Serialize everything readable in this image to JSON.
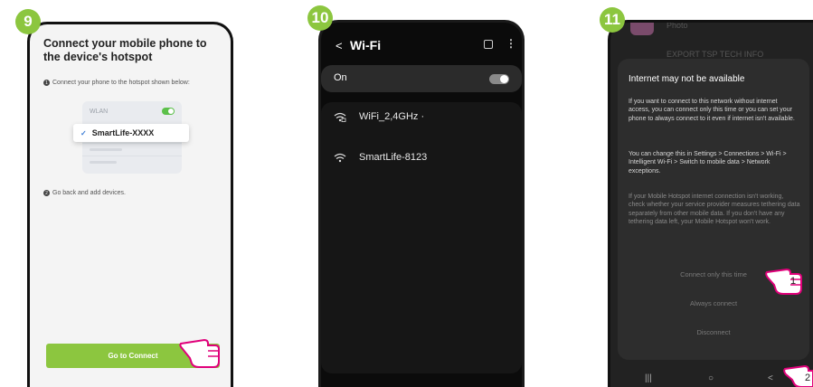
{
  "steps": [
    "9",
    "10",
    "11"
  ],
  "phone1": {
    "title": "Connect your mobile phone to the device's hotspot",
    "step1_num": "1",
    "step1_text": "Connect your phone to the hotspot shown below:",
    "wlan_label": "WLAN",
    "network_name": "SmartLife-XXXX",
    "step2_num": "2",
    "step2_text": "Go back and add devices.",
    "button_label": "Go to Connect"
  },
  "phone2": {
    "title": "Wi-Fi",
    "on_label": "On",
    "networks": [
      "WiFi_2,4GHz ·",
      "SmartLife-8123"
    ]
  },
  "phone3": {
    "bg_item1": "Photo",
    "bg_item2": "EXPORT TSP TECH INFO",
    "dialog_title": "Internet may not be available",
    "para1": "If you want to connect to this network without internet access, you can connect only this time or you can set your phone to always connect to it even if internet isn't available.",
    "para2": "You can change this in Settings > Connections > Wi-Fi > Intelligent Wi-Fi > Switch to mobile data > Network exceptions.",
    "para3": "If your Mobile Hotspot internet connection isn't working, check whether your service provider measures tethering data separately from other mobile data. If you don't have any tethering data left, your Mobile Hotspot won't work.",
    "option1": "Connect only this time",
    "option2": "Always connect",
    "option3": "Disconnect",
    "nav_recent": "|||",
    "nav_home": "○",
    "nav_back": "<"
  },
  "hand_labels": [
    "1",
    "2"
  ]
}
